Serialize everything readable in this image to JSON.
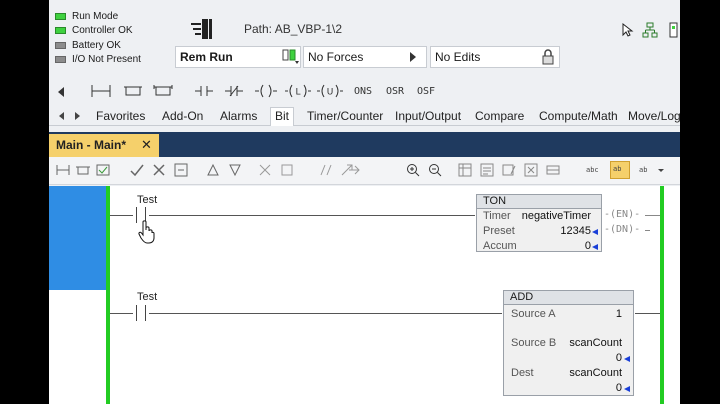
{
  "status": {
    "items": [
      {
        "label": "Run Mode",
        "color": "green"
      },
      {
        "label": "Controller OK",
        "color": "green"
      },
      {
        "label": "Battery OK",
        "color": "gray"
      },
      {
        "label": "I/O Not Present",
        "color": "gray"
      }
    ]
  },
  "controller": {
    "path_label": "Path:  AB_VBP-1\\2",
    "mode": "Rem Run",
    "forces": "No Forces",
    "edits": "No Edits"
  },
  "instructions": [
    "ONS",
    "OSR",
    "OSF"
  ],
  "instruction_tabs": [
    "Favorites",
    "Add-On",
    "Alarms",
    "Bit",
    "Timer/Counter",
    "Input/Output",
    "Compare",
    "Compute/Math",
    "Move/Log"
  ],
  "active_instruction_tab": "Bit",
  "routine_tab": {
    "label": "Main - Main*",
    "close": "✕"
  },
  "ladder_toolbar": {
    "text_icon_1": "abc",
    "text_icon_2": "ab",
    "text_icon_3": "ab"
  },
  "rungs": [
    {
      "contact_tag": "Test",
      "block": {
        "name": "TON",
        "rows": [
          {
            "label": "Timer",
            "value": "negativeTimer"
          },
          {
            "label": "Preset",
            "value": "12345"
          },
          {
            "label": "Accum",
            "value": "0"
          }
        ],
        "outputs": [
          "-(EN)-",
          "-(DN)-"
        ]
      }
    },
    {
      "contact_tag": "Test",
      "block": {
        "name": "ADD",
        "rows": [
          {
            "label": "Source A",
            "value": "1"
          },
          {
            "label": "Source B",
            "value": "scanCount",
            "subvalue": "0"
          },
          {
            "label": "Dest",
            "value": "scanCount",
            "subvalue": "0"
          }
        ]
      }
    }
  ],
  "colors": {
    "rail": "#22cc22",
    "selection": "#2f8de4",
    "doc_strip": "#1f3a5f",
    "active_doc_tab": "#f5d06b",
    "value_arrow": "#1a3fd8"
  }
}
